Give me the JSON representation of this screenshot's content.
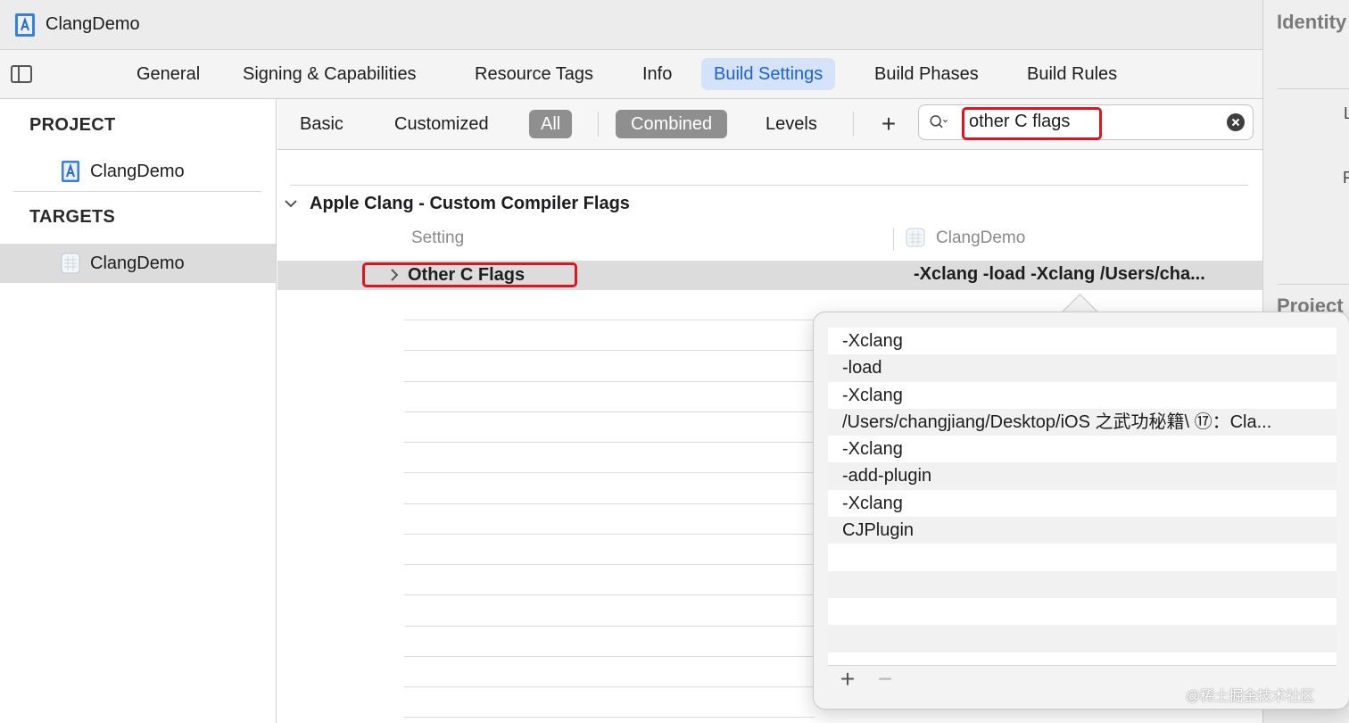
{
  "window": {
    "project_title": "ClangDemo"
  },
  "tabs": [
    {
      "label": "General",
      "active": false
    },
    {
      "label": "Signing & Capabilities",
      "active": false
    },
    {
      "label": "Resource Tags",
      "active": false
    },
    {
      "label": "Info",
      "active": false
    },
    {
      "label": "Build Settings",
      "active": true
    },
    {
      "label": "Build Phases",
      "active": false
    },
    {
      "label": "Build Rules",
      "active": false
    }
  ],
  "sidebar": {
    "project_header": "PROJECT",
    "project_item": "ClangDemo",
    "targets_header": "TARGETS",
    "target_item": "ClangDemo"
  },
  "filters": {
    "basic": "Basic",
    "customized": "Customized",
    "all": "All",
    "combined": "Combined",
    "levels": "Levels",
    "add": "+"
  },
  "search": {
    "value": "other C flags"
  },
  "settings": {
    "group_title": "Apple Clang - Custom Compiler Flags",
    "col_setting": "Setting",
    "col_target": "ClangDemo",
    "row_name": "Other C Flags",
    "row_value": "-Xclang -load -Xclang /Users/cha..."
  },
  "popover": {
    "values": [
      "-Xclang",
      "-load",
      "-Xclang",
      "/Users/changjiang/Desktop/iOS 之武功秘籍\\ ⑰：Cla...",
      "-Xclang",
      "-add-plugin",
      "-Xclang",
      "CJPlugin",
      "",
      "",
      "",
      ""
    ],
    "add": "+",
    "remove": "−"
  },
  "inspector": {
    "title": "Identity",
    "label_lo": "Lo",
    "label_fu": "Fu",
    "section": "Project"
  },
  "watermark": "@稀土掘金技术社区",
  "colors": {
    "accent": "#1a62d6",
    "active_tab_bg": "#d4e3fa",
    "highlight_red": "#e0141e",
    "selected_filter": "#8f8f8f"
  }
}
